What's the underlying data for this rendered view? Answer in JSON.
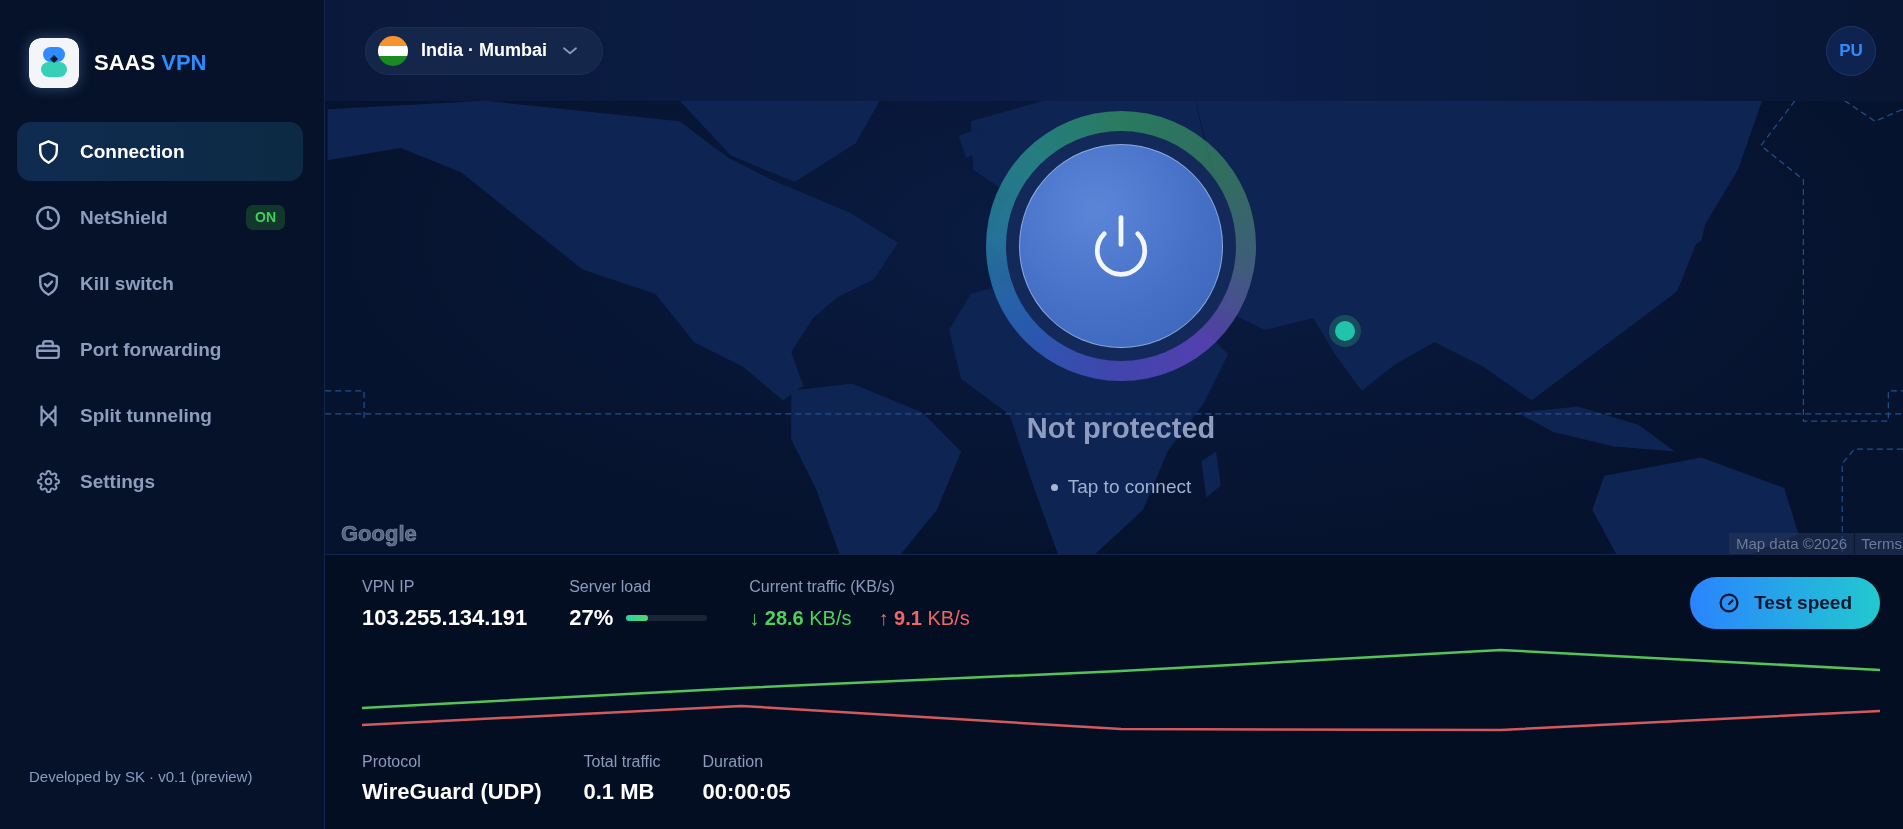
{
  "sidebar": {
    "brand": {
      "name": "SAAS",
      "accent": "VPN"
    },
    "items": [
      {
        "label": "Connection",
        "selected": true
      },
      {
        "label": "NetShield",
        "selected": false,
        "badge": "ON"
      },
      {
        "label": "Kill switch",
        "selected": false
      },
      {
        "label": "Port forwarding",
        "selected": false
      },
      {
        "label": "Split tunneling",
        "selected": false
      },
      {
        "label": "Settings",
        "selected": false
      }
    ],
    "footer": "Developed by SK · v0.1 (preview)"
  },
  "topbar": {
    "location": "India · Mumbai",
    "avatar": "PU"
  },
  "map": {
    "status": "Not protected",
    "hint": "Tap to connect",
    "logo": "Google",
    "attribution": "Map data ©2026",
    "terms": "Terms"
  },
  "stats": {
    "metrics": [
      {
        "kind": "text",
        "label": "VPN IP",
        "value": "103.255.134.191"
      },
      {
        "kind": "meter",
        "label": "Server load",
        "value": "27%",
        "level": 0.27
      },
      {
        "kind": "traffic",
        "label": "Current traffic (KB/s)",
        "traffic": [
          {
            "text": "↓ **28.6** KB/s",
            "color": "#4fd15c"
          },
          {
            "text": "↑ **9.1** KB/s",
            "color": "#f06565"
          }
        ]
      }
    ],
    "action": "Test speed",
    "details": [
      {
        "label": "Protocol",
        "value": "WireGuard (UDP)"
      },
      {
        "label": "Total traffic",
        "value": "0.1 MB"
      },
      {
        "label": "Duration",
        "value": "00:00:05"
      }
    ]
  }
}
